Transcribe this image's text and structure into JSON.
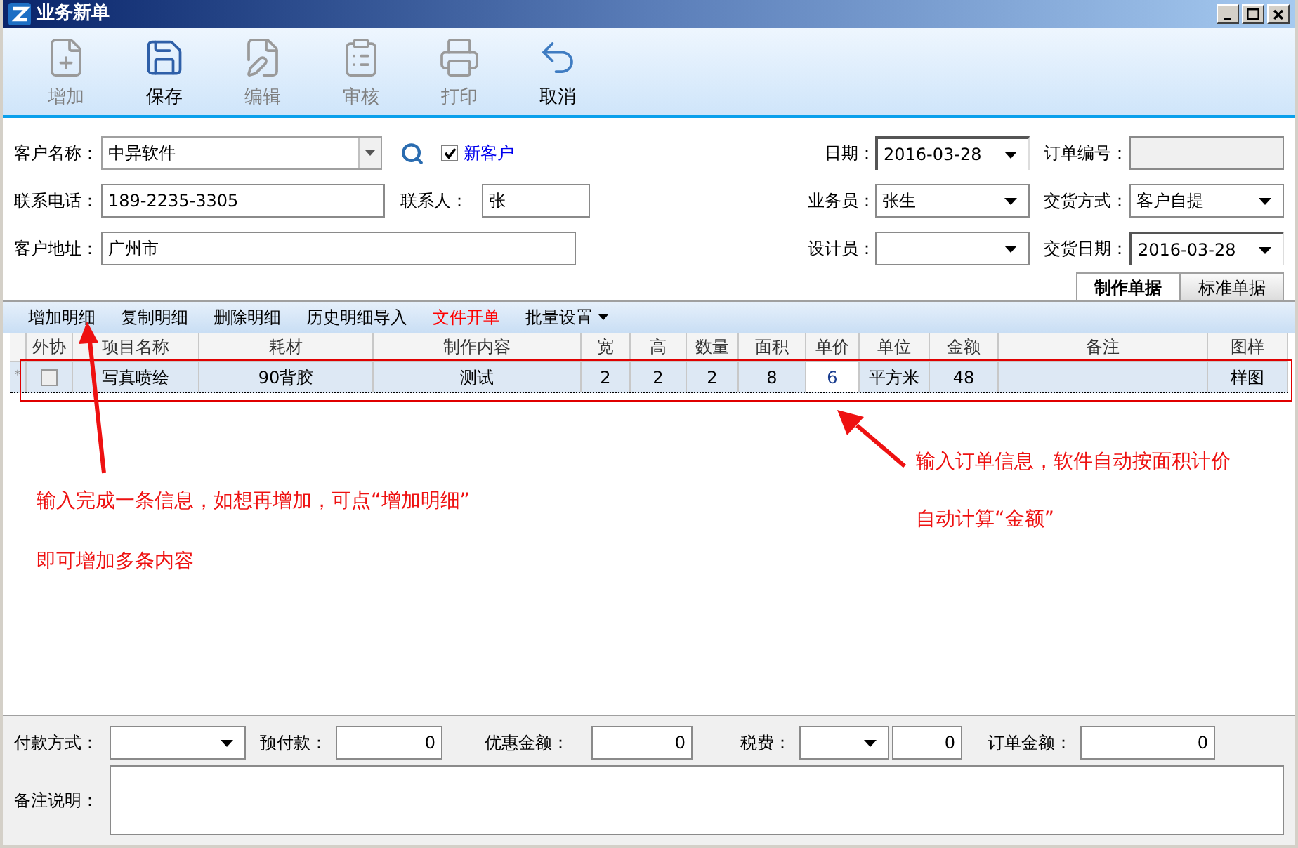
{
  "window": {
    "title": "业务新单"
  },
  "toolbar": [
    {
      "label": "增加",
      "kind": "add",
      "disabled": true
    },
    {
      "label": "保存",
      "kind": "save",
      "disabled": false
    },
    {
      "label": "编辑",
      "kind": "edit",
      "disabled": true
    },
    {
      "label": "审核",
      "kind": "review",
      "disabled": true
    },
    {
      "label": "打印",
      "kind": "print",
      "disabled": true
    },
    {
      "label": "取消",
      "kind": "cancel",
      "disabled": false
    }
  ],
  "form": {
    "customer": {
      "label": "客户名称：",
      "value": "中异软件"
    },
    "new_customer": {
      "label": "新客户",
      "checked": true
    },
    "phone": {
      "label": "联系电话：",
      "value": "189-2235-3305"
    },
    "contact": {
      "label": "联系人：",
      "value": "张"
    },
    "address": {
      "label": "客户地址：",
      "value": "广州市"
    },
    "date": {
      "label": "日期：",
      "value": "2016-03-28"
    },
    "order_no": {
      "label": "订单编号：",
      "disabled": true
    },
    "salesperson": {
      "label": "业务员：",
      "value": "张生"
    },
    "delivery_method": {
      "label": "交货方式：",
      "value": "客户自提"
    },
    "designer": {
      "label": "设计员："
    },
    "delivery_date": {
      "label": "交货日期：",
      "value": "2016-03-28"
    }
  },
  "tabs": [
    {
      "label": "制作单据",
      "selected": true
    },
    {
      "label": "标准单据",
      "selected": false
    }
  ],
  "detail_toolbar": [
    {
      "label": "增加明细",
      "highlighted": false,
      "has_menu": false
    },
    {
      "label": "复制明细",
      "highlighted": false,
      "has_menu": false
    },
    {
      "label": "删除明细",
      "highlighted": false,
      "has_menu": false
    },
    {
      "label": "历史明细导入",
      "highlighted": false,
      "has_menu": false
    },
    {
      "label": "文件开单",
      "highlighted": true,
      "has_menu": false
    },
    {
      "label": "批量设置",
      "highlighted": false,
      "has_menu": true
    }
  ],
  "table": {
    "columns": [
      "外协",
      "项目名称",
      "耗材",
      "制作内容",
      "宽",
      "高",
      "数量",
      "面积",
      "单价",
      "单位",
      "金额",
      "备注",
      "图样"
    ],
    "rows": [
      {
        "marker": "*",
        "cells": [
          {
            "kind": "checkbox",
            "checked": false
          },
          {
            "kind": "text",
            "text": "写真喷绘",
            "selected": false
          },
          {
            "kind": "text",
            "text": "90背胶",
            "selected": false
          },
          {
            "kind": "text",
            "text": "测试",
            "selected": false
          },
          {
            "kind": "text",
            "text": "2",
            "selected": false
          },
          {
            "kind": "text",
            "text": "2",
            "selected": false
          },
          {
            "kind": "text",
            "text": "2",
            "selected": false
          },
          {
            "kind": "text",
            "text": "8",
            "selected": false
          },
          {
            "kind": "text",
            "text": "6",
            "selected": true
          },
          {
            "kind": "text",
            "text": "平方米",
            "selected": false
          },
          {
            "kind": "text",
            "text": "48",
            "selected": false
          },
          {
            "kind": "empty",
            "selected": false
          },
          {
            "kind": "text",
            "text": "样图",
            "selected": false
          }
        ]
      }
    ]
  },
  "annotations": {
    "left": [
      "输入完成一条信息，如想再增加，可点“增加明细”",
      "即可增加多条内容"
    ],
    "right": [
      "输入订单信息，软件自动按面积计价",
      "自动计算“金额”"
    ]
  },
  "footer": {
    "payment_method": {
      "label": "付款方式："
    },
    "prepayment": {
      "label": "预付款：",
      "value": "0"
    },
    "discount": {
      "label": "优惠金额：",
      "value": "0"
    },
    "tax": {
      "label": "税费：",
      "value": "0"
    },
    "order_total": {
      "label": "订单金额：",
      "value": "0"
    },
    "remarks": {
      "label": "备注说明："
    }
  }
}
